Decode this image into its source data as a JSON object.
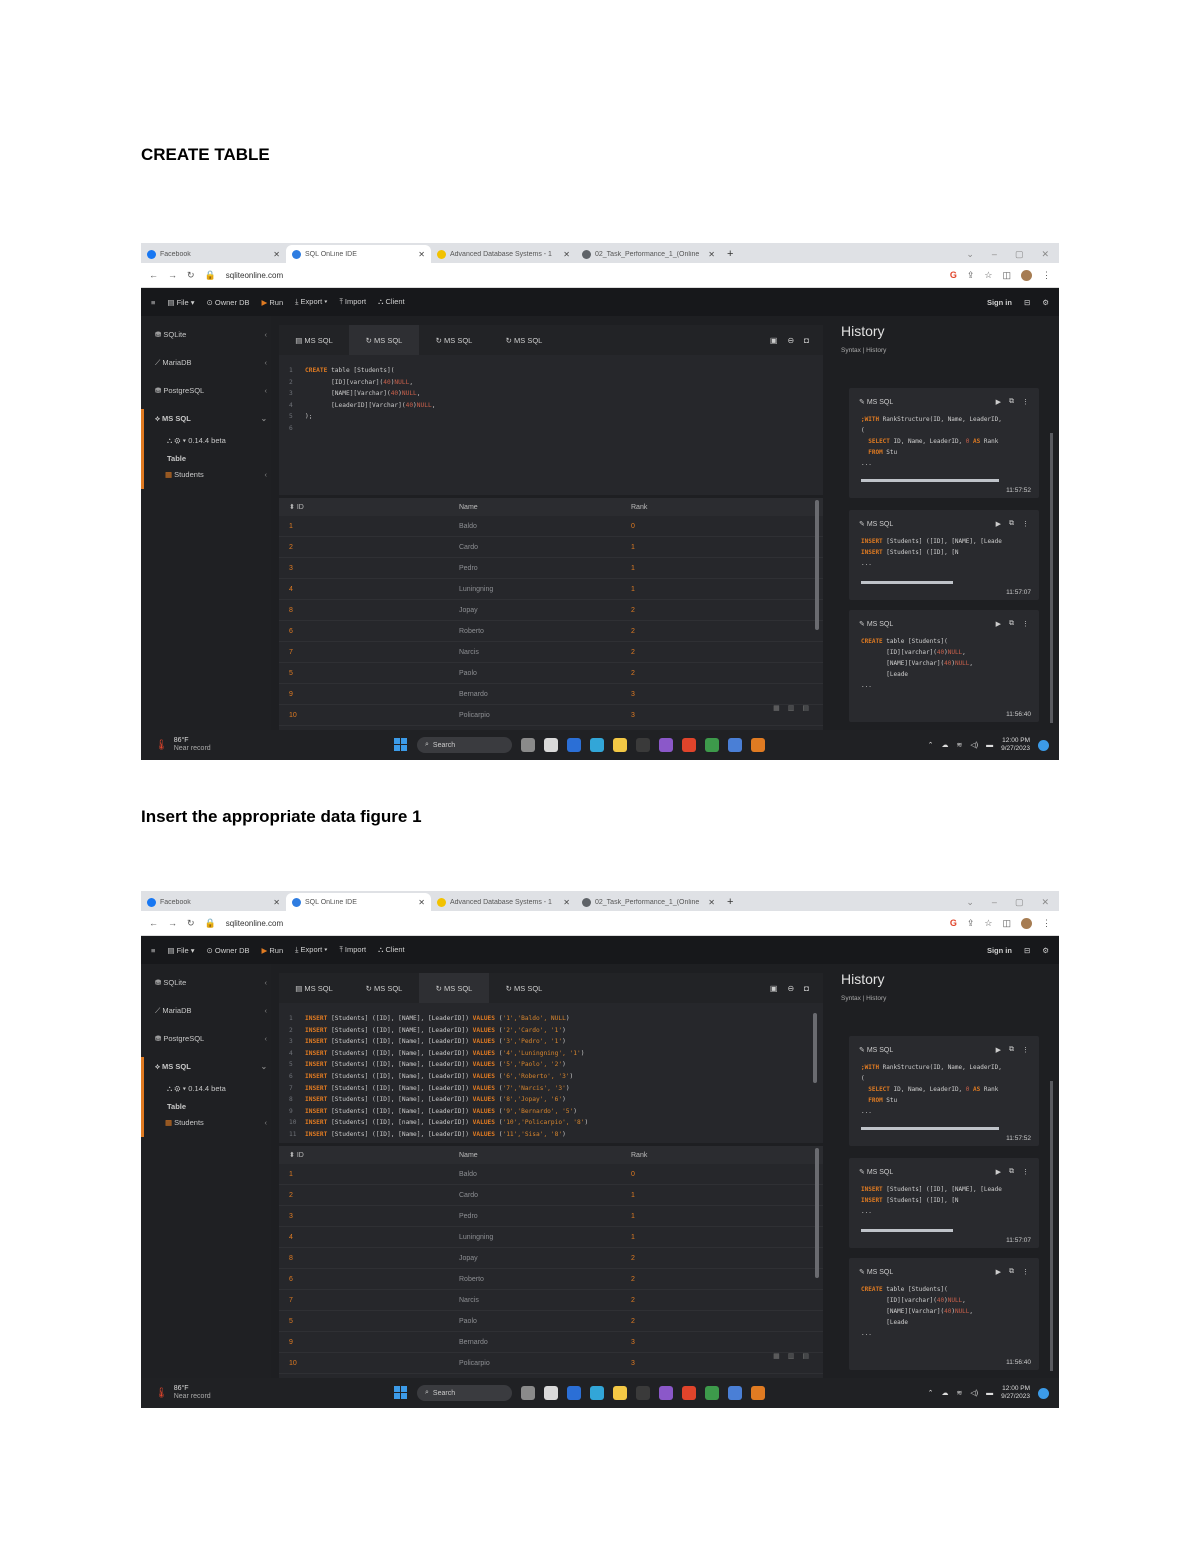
{
  "heading1": "CREATE TABLE",
  "heading2": "Insert the appropriate data figure 1",
  "browser": {
    "tabs": [
      {
        "label": "Facebook",
        "color": "#1877f2"
      },
      {
        "label": "SQL OnLine IDE",
        "color": "#2f7de1"
      },
      {
        "label": "Advanced Database Systems - 1",
        "color": "#f2c200"
      },
      {
        "label": "02_Task_Performance_1_(Online",
        "color": "#5f6368"
      }
    ],
    "url": "sqliteonline.com"
  },
  "toolbar": {
    "file": "File",
    "owner_db": "Owner DB",
    "run": "Run",
    "export": "Export",
    "import": "Import",
    "client": "Client",
    "sign_in": "Sign in"
  },
  "sidebar": {
    "sqlite": "SQLite",
    "mariadb": "MariaDB",
    "postgresql": "PostgreSQL",
    "mssql": "MS SQL",
    "version": "0.14.4 beta",
    "table": "Table",
    "students": "Students"
  },
  "editor_tabs": [
    "MS SQL",
    "MS SQL",
    "MS SQL",
    "MS SQL"
  ],
  "results": {
    "headers": [
      "ID",
      "Name",
      "Rank"
    ],
    "rows": [
      [
        "1",
        "Baldo",
        "0"
      ],
      [
        "2",
        "Cardo",
        "1"
      ],
      [
        "3",
        "Pedro",
        "1"
      ],
      [
        "4",
        "Luningning",
        "1"
      ],
      [
        "8",
        "Jopay",
        "2"
      ],
      [
        "6",
        "Roberto",
        "2"
      ],
      [
        "7",
        "Narcis",
        "2"
      ],
      [
        "5",
        "Paolo",
        "2"
      ],
      [
        "9",
        "Bernardo",
        "3"
      ],
      [
        "10",
        "Policarpio",
        "3"
      ]
    ]
  },
  "history": {
    "title": "History",
    "subtitle": "Syntax | History",
    "cards": [
      {
        "label": "MS SQL",
        "time": "11:57:52"
      },
      {
        "label": "MS SQL",
        "time": "11:57:07"
      },
      {
        "label": "MS SQL",
        "time": "11:56:40"
      }
    ]
  },
  "taskbar": {
    "temp": "86°F",
    "weather": "Near record",
    "search": "Search",
    "time": "12:00 PM",
    "date": "9/27/2023"
  },
  "colors": {
    "accent": "#e07b22",
    "background": "#1e1f22"
  }
}
